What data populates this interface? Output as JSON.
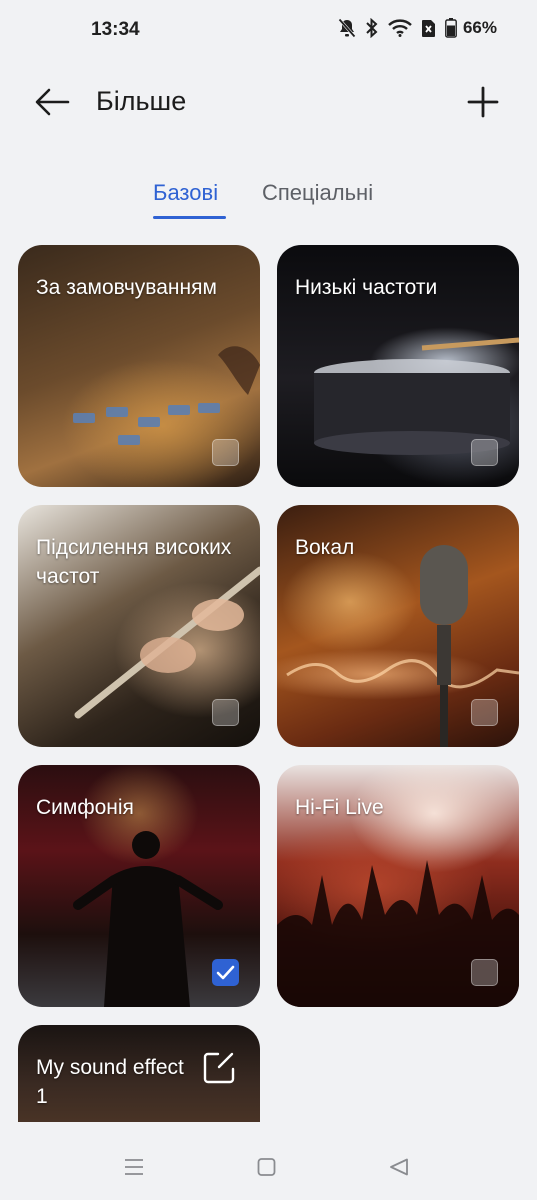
{
  "status": {
    "time": "13:34",
    "battery": "66%",
    "icons": [
      "mute-icon",
      "bluetooth-icon",
      "wifi-icon",
      "sim-icon",
      "battery-icon"
    ]
  },
  "header": {
    "title": "Більше",
    "back_icon": "back-arrow-icon",
    "add_icon": "plus-icon"
  },
  "tabs": [
    {
      "label": "Базові",
      "active": true
    },
    {
      "label": "Спеціальні",
      "active": false
    }
  ],
  "presets": [
    {
      "label": "За замовчуванням",
      "selected": false
    },
    {
      "label": "Низькі частоти",
      "selected": false
    },
    {
      "label": "Підсилення високих частот",
      "selected": false
    },
    {
      "label": "Вокал",
      "selected": false
    },
    {
      "label": "Симфонія",
      "selected": true
    },
    {
      "label": "Hi-Fi Live",
      "selected": false
    },
    {
      "label": "My sound effect 1",
      "selected": false
    }
  ],
  "colors": {
    "accent": "#2f62d3",
    "background": "#f1f2f4"
  },
  "navbar": {
    "icons": [
      "menu-icon",
      "home-icon",
      "back-icon"
    ]
  }
}
